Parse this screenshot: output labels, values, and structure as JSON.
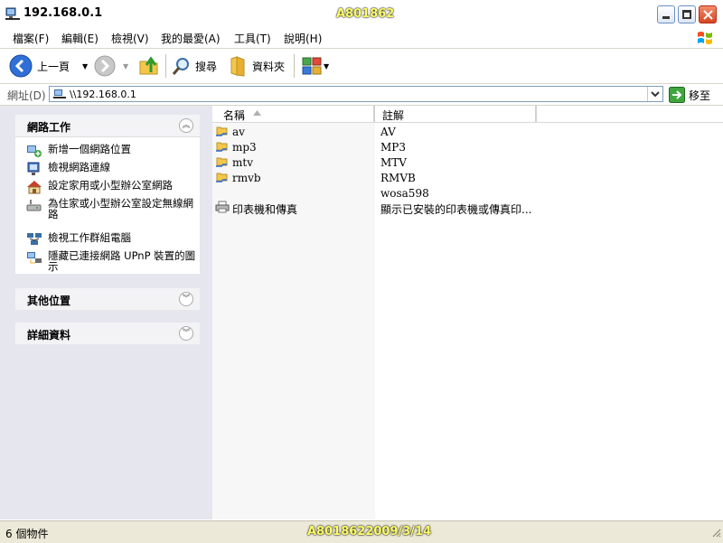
{
  "window": {
    "title": "192.168.0.1",
    "watermark": "A801862",
    "buttons": {
      "minimize": "minimize",
      "maximize": "maximize",
      "close": "close"
    }
  },
  "menu": {
    "items": [
      "檔案(F)",
      "編輯(E)",
      "檢視(V)",
      "我的最愛(A)",
      "工具(T)",
      "說明(H)"
    ]
  },
  "toolbar": {
    "back_label": "上一頁",
    "search_label": "搜尋",
    "folders_label": "資料夾"
  },
  "address": {
    "label": "網址(D)",
    "value": "\\\\192.168.0.1",
    "go_label": "移至"
  },
  "sidebar": {
    "network_tasks": {
      "title": "網路工作",
      "items": [
        {
          "label": "新增一個網路位置",
          "icon": "add-network-place-icon"
        },
        {
          "label": "檢視網路連線",
          "icon": "network-connections-icon"
        },
        {
          "label": "設定家用或小型辦公室網路",
          "icon": "home-network-icon"
        },
        {
          "label": "為住家或小型辦公室設定無線網路",
          "icon": "wireless-network-icon"
        },
        {
          "label": "檢視工作群組電腦",
          "icon": "workgroup-computers-icon"
        },
        {
          "label": "隱藏已連接網路 UPnP 裝置的圖示",
          "icon": "upnp-devices-icon"
        }
      ]
    },
    "other_places": {
      "title": "其他位置"
    },
    "details": {
      "title": "詳細資料"
    }
  },
  "filelist": {
    "columns": {
      "name": "名稱",
      "comment": "註解"
    },
    "rows": [
      {
        "name": "av",
        "comment": "AV",
        "icon": "shared-folder-icon"
      },
      {
        "name": "mp3",
        "comment": "MP3",
        "icon": "shared-folder-icon"
      },
      {
        "name": "mtv",
        "comment": "MTV",
        "icon": "shared-folder-icon"
      },
      {
        "name": "rmvb",
        "comment": "RMVB",
        "icon": "shared-folder-icon"
      },
      {
        "name": "",
        "comment": "wosa598",
        "icon": ""
      },
      {
        "name": "印表機和傳真",
        "comment": "顯示已安裝的印表機或傳真印...",
        "icon": "printers-faxes-icon"
      }
    ]
  },
  "status": {
    "count_text": "6 個物件",
    "watermark": "A8018622009/3/14"
  }
}
